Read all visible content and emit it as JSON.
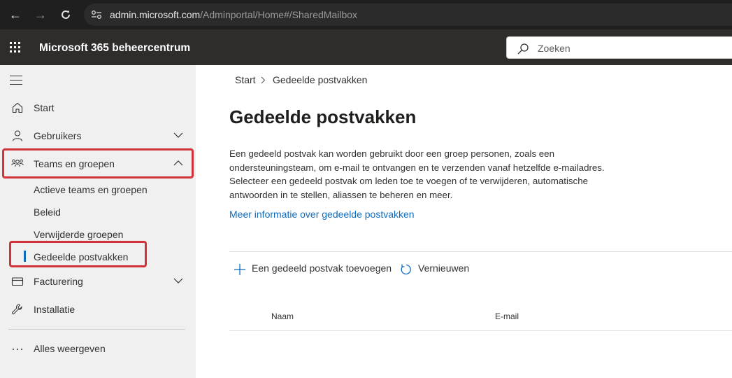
{
  "browser": {
    "url_host": "admin.microsoft.com",
    "url_path": "/Adminportal/Home#/SharedMailbox"
  },
  "header": {
    "app_title": "Microsoft 365 beheercentrum",
    "search_placeholder": "Zoeken"
  },
  "sidebar": {
    "items": [
      {
        "label": "Start",
        "icon": "home-icon"
      },
      {
        "label": "Gebruikers",
        "icon": "person-icon",
        "expanded": false
      },
      {
        "label": "Teams en groepen",
        "icon": "people-team-icon",
        "expanded": true
      },
      {
        "label": "Facturering",
        "icon": "billing-icon",
        "expanded": false
      },
      {
        "label": "Installatie",
        "icon": "wrench-icon"
      }
    ],
    "subitems": [
      {
        "label": "Actieve teams en groepen"
      },
      {
        "label": "Beleid"
      },
      {
        "label": "Verwijderde groepen"
      },
      {
        "label": "Gedeelde postvakken",
        "active": true
      }
    ],
    "show_all": "Alles weergeven"
  },
  "main": {
    "breadcrumb": [
      "Start",
      "Gedeelde postvakken"
    ],
    "title": "Gedeelde postvakken",
    "description": "Een gedeeld postvak kan worden gebruikt door een groep personen, zoals een ondersteuningsteam, om e-mail te ontvangen en te verzenden vanaf hetzelfde e-mailadres. Selecteer een gedeeld postvak om leden toe te voegen of te verwijderen, automatische antwoorden in te stellen, aliassen te beheren en meer.",
    "learn_more_link": "Meer informatie over gedeelde postvakken",
    "commands": {
      "add": "Een gedeeld postvak toevoegen",
      "refresh": "Vernieuwen"
    },
    "table_columns": [
      "Naam",
      "E-mail"
    ]
  },
  "colors": {
    "accent": "#0f6cbd",
    "highlight_border": "#d13438",
    "topbar": "#2f2d2c",
    "sidebar_bg": "#f0f0f0"
  }
}
